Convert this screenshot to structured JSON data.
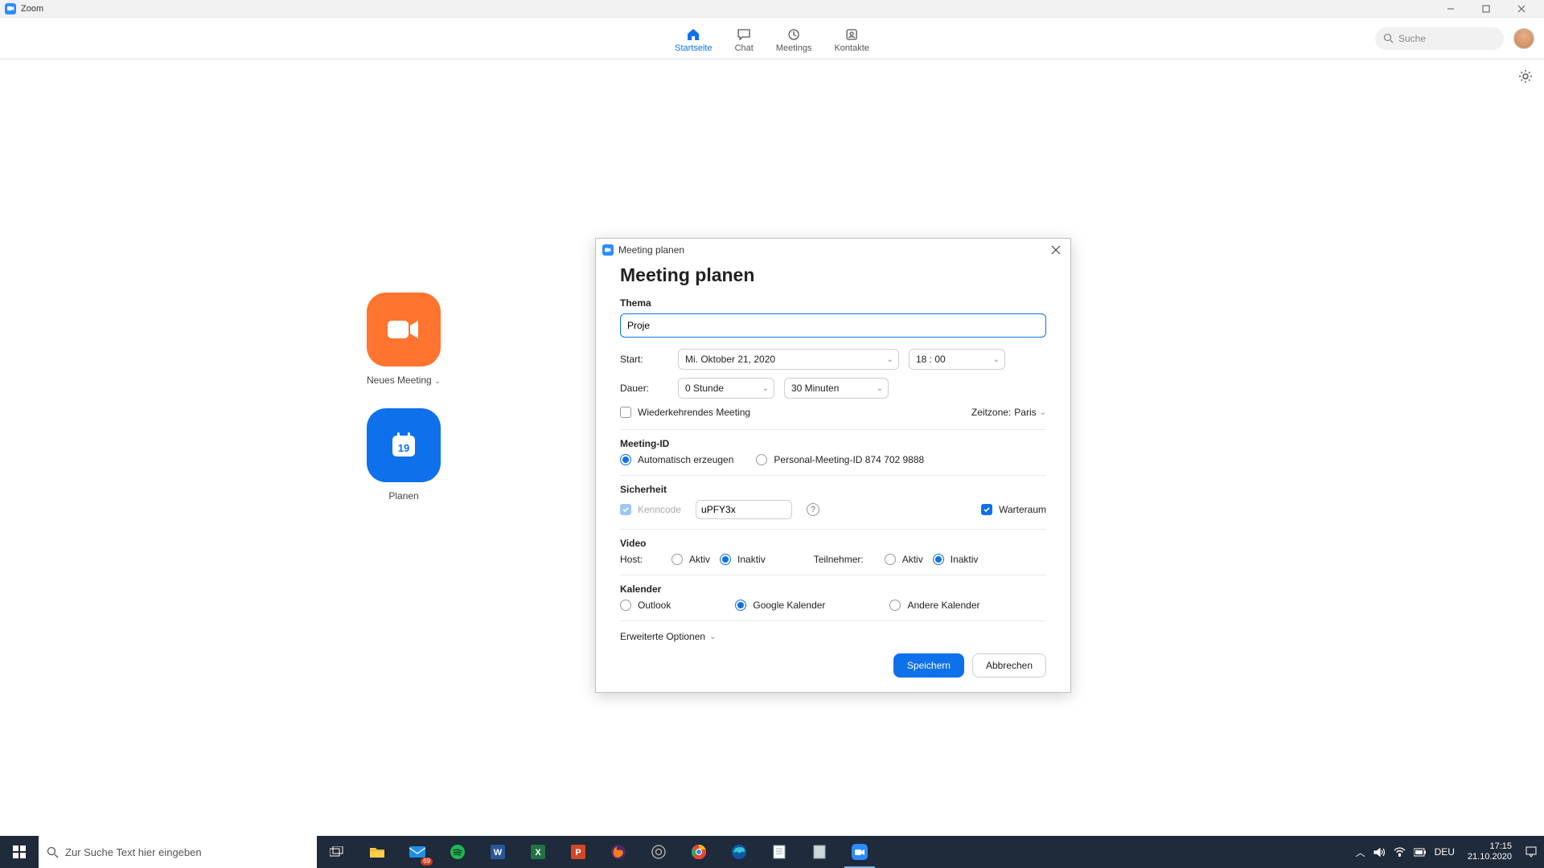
{
  "window": {
    "title": "Zoom"
  },
  "nav": {
    "home": "Startseite",
    "chat": "Chat",
    "meetings": "Meetings",
    "contacts": "Kontakte",
    "search_placeholder": "Suche"
  },
  "home": {
    "new_meeting": "Neues Meeting",
    "schedule": "Planen",
    "calendar_day": "19"
  },
  "modal": {
    "titlebar": "Meeting planen",
    "heading": "Meeting planen",
    "thema_label": "Thema",
    "thema_value": "Proje",
    "start_label": "Start:",
    "date_value": "Mi.  Oktober  21,  2020",
    "time_value": "18 : 00",
    "duration_label": "Dauer:",
    "hours_value": "0 Stunde",
    "minutes_value": "30 Minuten",
    "recurring": "Wiederkehrendes Meeting",
    "timezone_label": "Zeitzone:",
    "timezone_value": "Paris",
    "meeting_id_label": "Meeting-ID",
    "auto_generate": "Automatisch erzeugen",
    "personal_id": "Personal-Meeting-ID 874 702 9888",
    "security_label": "Sicherheit",
    "passcode_label": "Kenncode",
    "passcode_value": "uPFY3x",
    "waiting_room": "Warteraum",
    "video_label": "Video",
    "host_label": "Host:",
    "participants_label": "Teilnehmer:",
    "active": "Aktiv",
    "inactive": "Inaktiv",
    "calendar_label": "Kalender",
    "outlook": "Outlook",
    "google": "Google Kalender",
    "other": "Andere Kalender",
    "advanced": "Erweiterte Optionen",
    "save": "Speichern",
    "cancel": "Abbrechen"
  },
  "taskbar": {
    "search_placeholder": "Zur Suche Text hier eingeben",
    "lang": "DEU",
    "time": "17:15",
    "date": "21.10.2020",
    "mail_badge": "69"
  }
}
